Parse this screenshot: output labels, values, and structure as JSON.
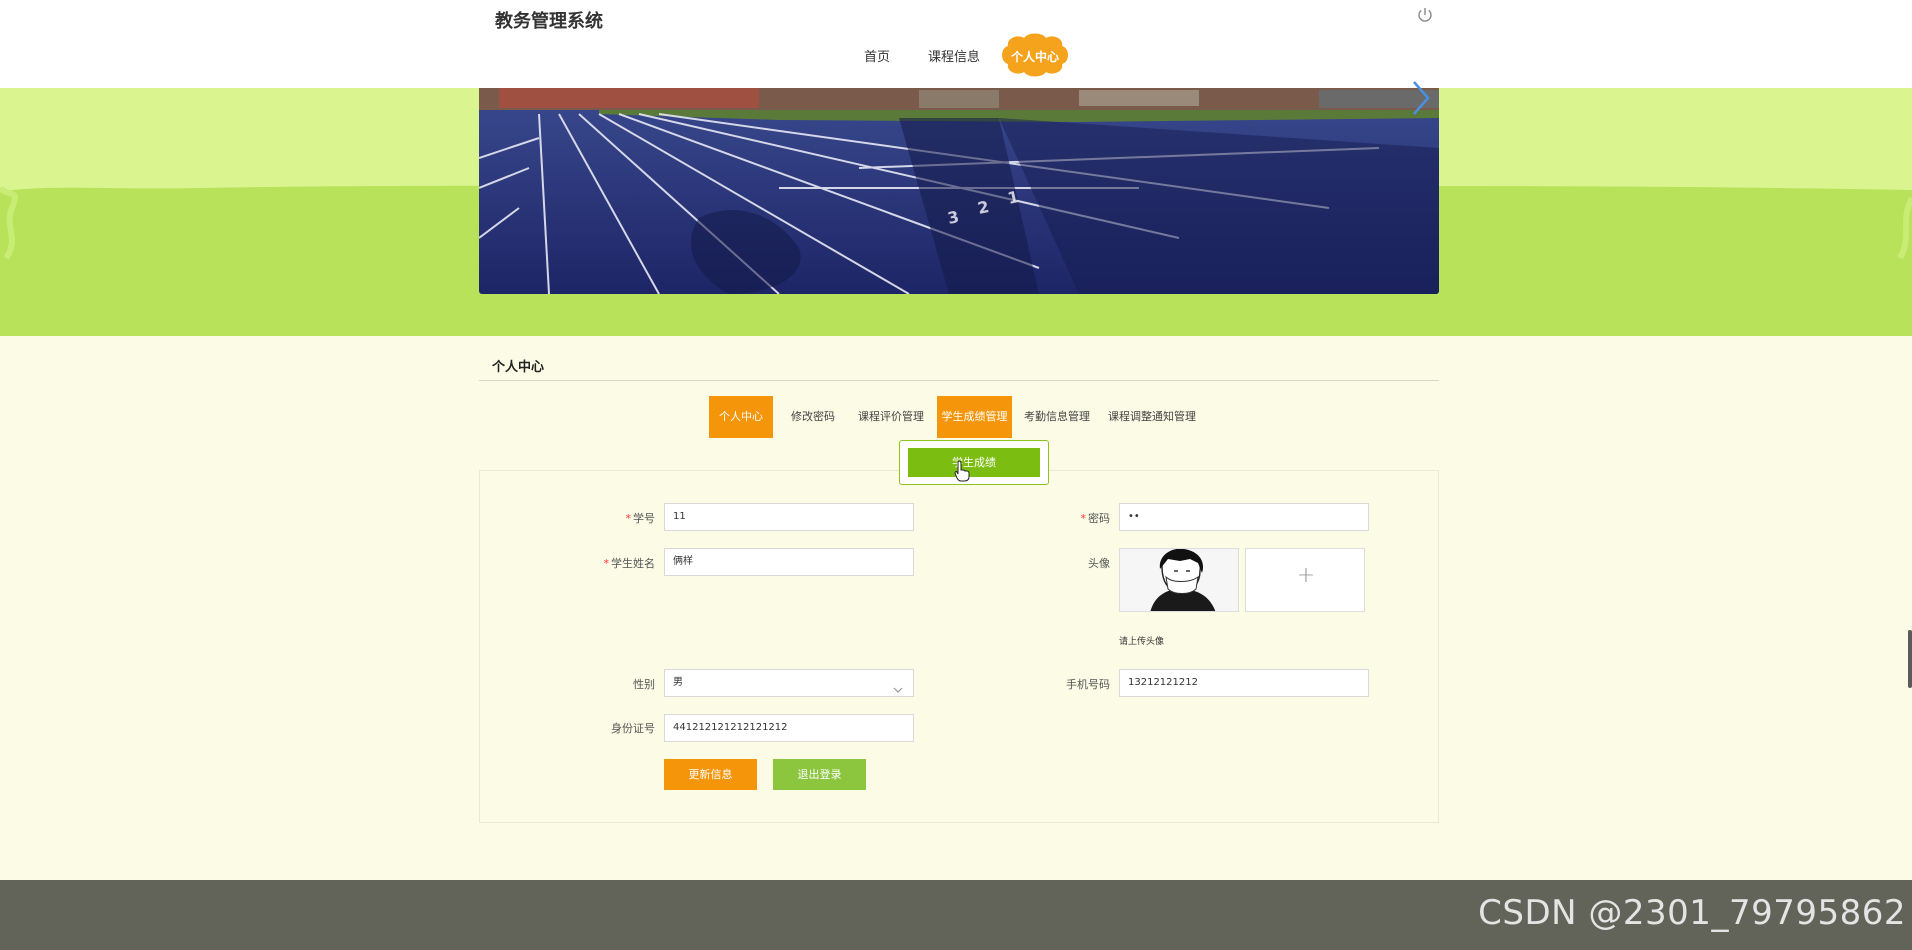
{
  "header": {
    "site_title": "教务管理系统",
    "nav": [
      {
        "label": "首页"
      },
      {
        "label": "课程信息"
      },
      {
        "label": "个人中心"
      }
    ]
  },
  "section": {
    "title": "个人中心"
  },
  "tabs": [
    {
      "label": "个人中心",
      "active": true
    },
    {
      "label": "修改密码",
      "active": false
    },
    {
      "label": "课程评价管理",
      "active": false
    },
    {
      "label": "学生成绩管理",
      "active": true
    },
    {
      "label": "考勤信息管理",
      "active": false
    },
    {
      "label": "课程调整通知管理",
      "active": false
    }
  ],
  "dropdown": {
    "item": "学生成绩"
  },
  "form": {
    "student_id_label": "学号",
    "student_id_value": "11",
    "password_label": "密码",
    "password_value": "••",
    "name_label": "学生姓名",
    "name_value": "俩样",
    "avatar_label": "头像",
    "upload_plus": "+",
    "upload_hint": "请上传头像",
    "gender_label": "性别",
    "gender_value": "男",
    "phone_label": "手机号码",
    "phone_value": "13212121212",
    "idcard_label": "身份证号",
    "idcard_value": "441212121212121212",
    "required_mark": "*"
  },
  "buttons": {
    "update": "更新信息",
    "logout": "退出登录"
  },
  "watermark": "CSDN @2301_79795862",
  "colors": {
    "accent_orange": "#f5950a",
    "accent_green": "#8cc63f",
    "banner_green": "#daf590",
    "page_bg": "#fbfbe6",
    "footer": "#62645a"
  },
  "icons": {
    "power": "power-icon",
    "banner_next": "chevron-right-icon",
    "select": "chevron-down-icon",
    "cursor": "hand-pointer-icon"
  }
}
